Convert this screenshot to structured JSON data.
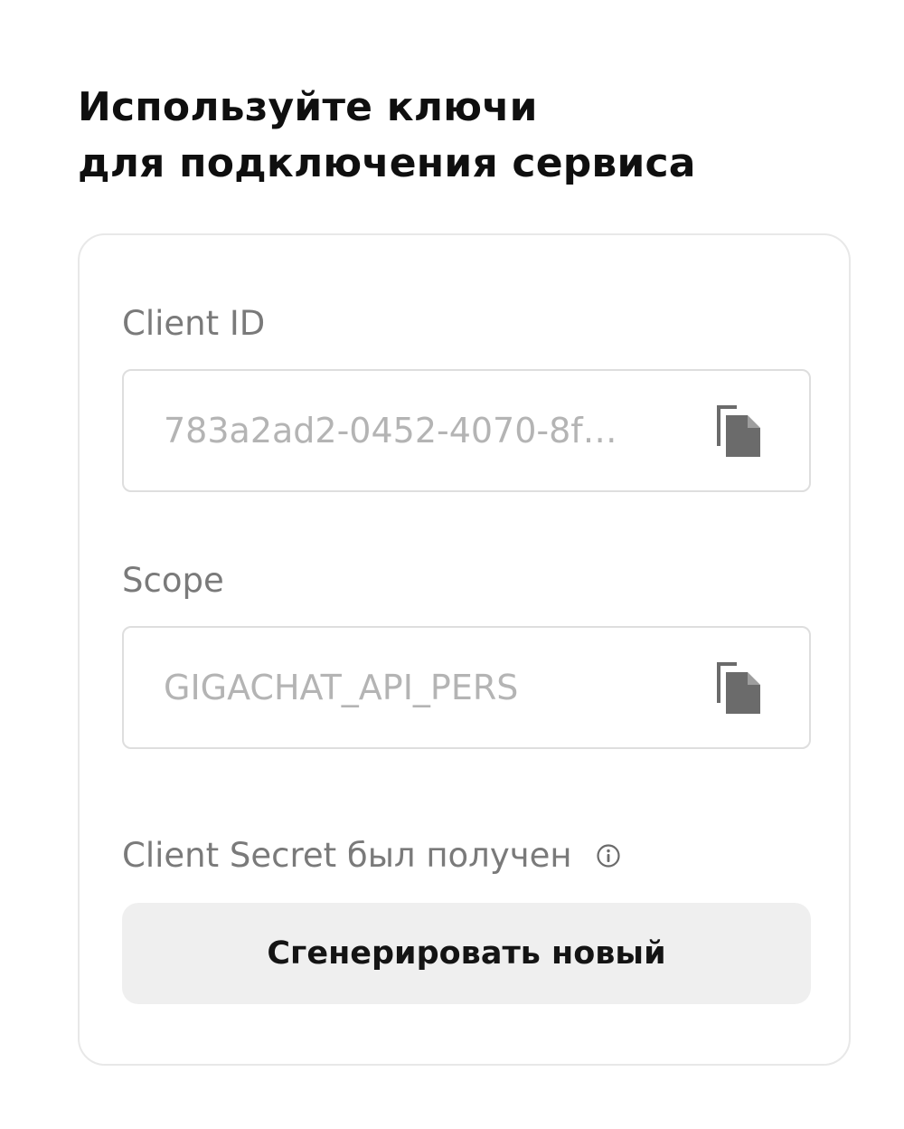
{
  "header": {
    "title_line1": "Используйте ключи",
    "title_line2": "для подключения сервиса"
  },
  "fields": [
    {
      "label": "Client ID",
      "value": "783a2ad2-0452-4070-8f…",
      "action_icon": "copy-icon"
    },
    {
      "label": "Scope",
      "value": "GIGACHAT_API_PERS",
      "action_icon": "copy-icon"
    }
  ],
  "secret": {
    "status_text": "Client Secret был получен",
    "info_icon": "info-icon",
    "button_label": "Сгенерировать новый"
  },
  "colors": {
    "title": "#0f0f0f",
    "label": "#7a7a7a",
    "value": "#b4b4b4",
    "card_border": "#e8e8e8",
    "button_bg": "#efefef",
    "icon": "#6b6b6b"
  }
}
